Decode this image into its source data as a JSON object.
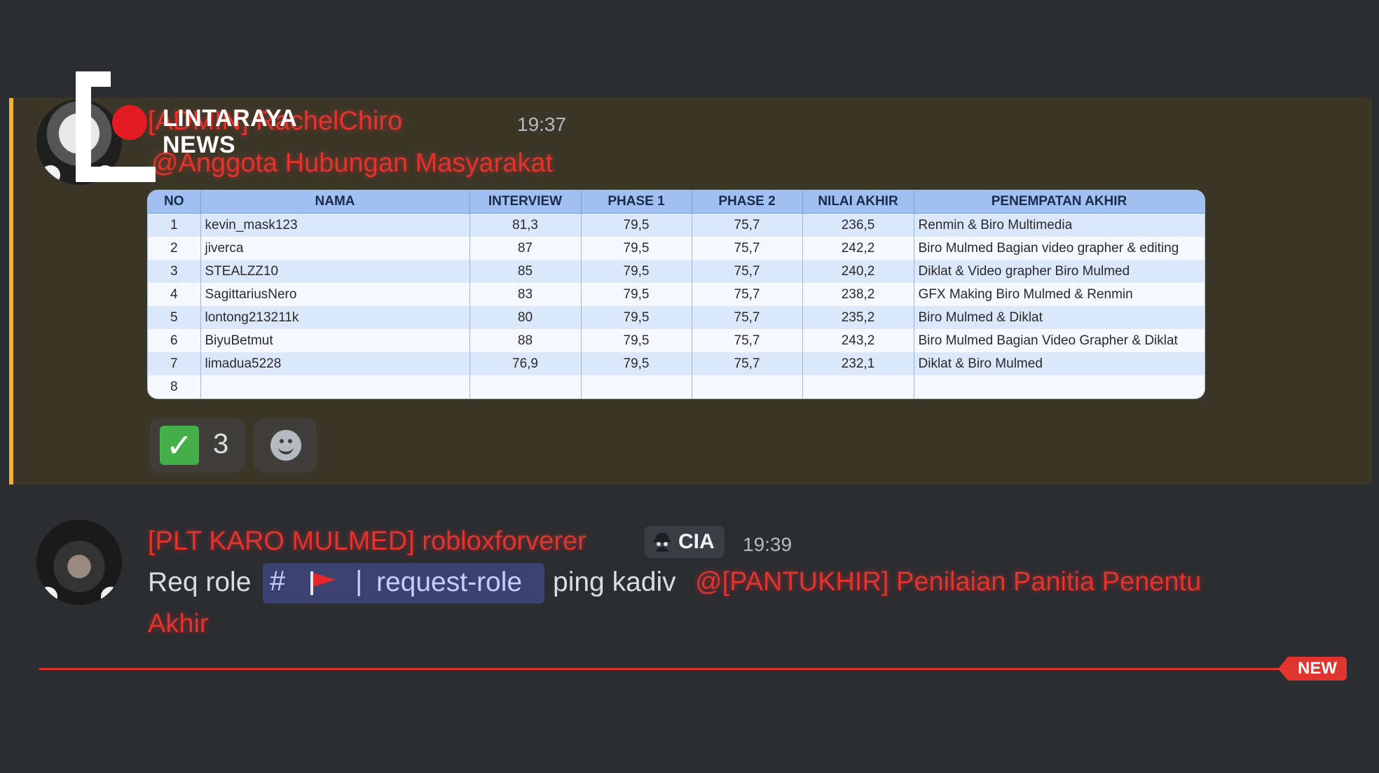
{
  "message1": {
    "username": "[ADMIN] RachelChiro",
    "timestamp": "19:37",
    "mention": "@Anggota Hubungan Masyarakat",
    "reaction": {
      "emoji": "check-mark-icon",
      "count": "3"
    }
  },
  "watermark": {
    "line1": "LINTARAYA",
    "line2": "NEWS"
  },
  "table": {
    "headers": [
      "NO",
      "NAMA",
      "INTERVIEW",
      "PHASE 1",
      "PHASE 2",
      "NILAI AKHIR",
      "PENEMPATAN AKHIR"
    ],
    "rows": [
      [
        "1",
        "kevin_mask123",
        "81,3",
        "79,5",
        "75,7",
        "236,5",
        "Renmin & Biro Multimedia"
      ],
      [
        "2",
        "jiverca",
        "87",
        "79,5",
        "75,7",
        "242,2",
        "Biro Mulmed Bagian video grapher & editing"
      ],
      [
        "3",
        "STEALZZ10",
        "85",
        "79,5",
        "75,7",
        "240,2",
        "Diklat & Video grapher Biro Mulmed"
      ],
      [
        "4",
        "SagittariusNero",
        "83",
        "79,5",
        "75,7",
        "238,2",
        "GFX Making Biro Mulmed & Renmin"
      ],
      [
        "5",
        "lontong213211k",
        "80",
        "79,5",
        "75,7",
        "235,2",
        "Biro Mulmed & Diklat"
      ],
      [
        "6",
        "BiyuBetmut",
        "88",
        "79,5",
        "75,7",
        "243,2",
        "Biro Mulmed Bagian Video Grapher & Diklat"
      ],
      [
        "7",
        "limadua5228",
        "76,9",
        "79,5",
        "75,7",
        "232,1",
        "Diklat & Biro Mulmed"
      ],
      [
        "8",
        "",
        "",
        "",
        "",
        "",
        ""
      ]
    ]
  },
  "message2": {
    "username": "[PLT KARO MULMED] robloxforverer",
    "badge": "CIA",
    "timestamp": "19:39",
    "text_before": "Req role",
    "channel": {
      "hash": "#",
      "separator": "|",
      "name": "request-role"
    },
    "text_after": "ping kadiv",
    "mention_line1": "@[PANTUKHIR] Penilaian Panitia Penentu",
    "mention_line2": "Akhir"
  },
  "divider": {
    "label": "NEW"
  },
  "colors": {
    "accent_red": "#e0342e",
    "highlight_bar": "#f0b232",
    "background": "#2b2d31"
  }
}
